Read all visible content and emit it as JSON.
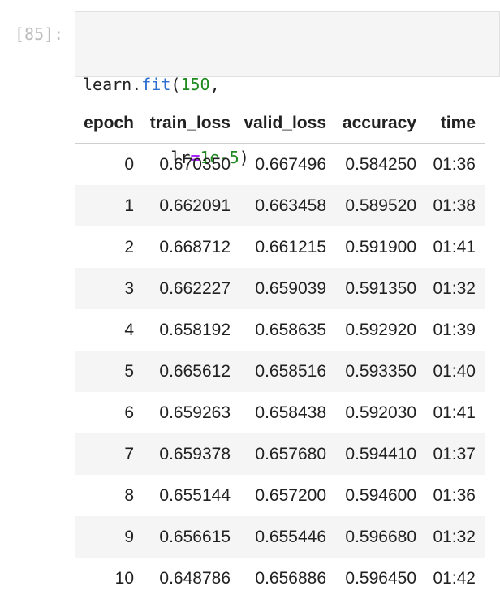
{
  "cell": {
    "prompt": "[85]:",
    "code": {
      "line1": {
        "name": "learn",
        "dot": ".",
        "method": "fit",
        "open": "(",
        "arg1": "150",
        "comma": ","
      },
      "line2": {
        "indent": "         ",
        "kw": "lr",
        "eq": "=",
        "val": "1e-5",
        "close": ")"
      }
    }
  },
  "table": {
    "columns": [
      "epoch",
      "train_loss",
      "valid_loss",
      "accuracy",
      "time"
    ],
    "rows": [
      [
        "0",
        "0.670350",
        "0.667496",
        "0.584250",
        "01:36"
      ],
      [
        "1",
        "0.662091",
        "0.663458",
        "0.589520",
        "01:38"
      ],
      [
        "2",
        "0.668712",
        "0.661215",
        "0.591900",
        "01:41"
      ],
      [
        "3",
        "0.662227",
        "0.659039",
        "0.591350",
        "01:32"
      ],
      [
        "4",
        "0.658192",
        "0.658635",
        "0.592920",
        "01:39"
      ],
      [
        "5",
        "0.665612",
        "0.658516",
        "0.593350",
        "01:40"
      ],
      [
        "6",
        "0.659263",
        "0.658438",
        "0.592030",
        "01:41"
      ],
      [
        "7",
        "0.659378",
        "0.657680",
        "0.594410",
        "01:37"
      ],
      [
        "8",
        "0.655144",
        "0.657200",
        "0.594600",
        "01:36"
      ],
      [
        "9",
        "0.656615",
        "0.655446",
        "0.596680",
        "01:32"
      ],
      [
        "10",
        "0.648786",
        "0.656886",
        "0.596450",
        "01:42"
      ]
    ]
  }
}
